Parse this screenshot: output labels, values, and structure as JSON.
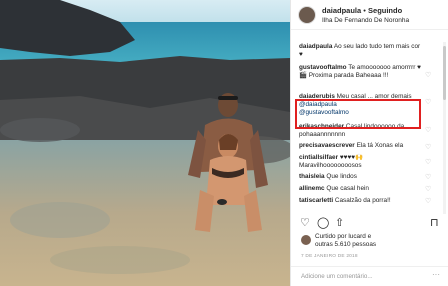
{
  "post": {
    "username": "daiadpaula",
    "separator": "•",
    "follow_label": "Seguindo",
    "location": "Ilha De Fernando De Noronha"
  },
  "comments": [
    {
      "user": "daiadpaula",
      "text": "Ao seu lado tudo tem mais cor",
      "extra": "♥"
    },
    {
      "user": "gustavooftalmo",
      "text": "Te amooooooo amorrrrr ♥🎬 Proxima parada Baheaaa !!!"
    },
    {
      "user": "daiaderubis",
      "text": "Meu casal ... amor demais",
      "mention1": "@daiadpaula",
      "mention2": "@gustavooftalmo"
    },
    {
      "user": "erikaschneider",
      "text": "Casal lindoooooo da pohaaannnnnnn"
    },
    {
      "user": "precisavaescrever",
      "text": "Ela tá Xonas ela"
    },
    {
      "user": "cintiallsilfaer",
      "text": "♥♥♥♥🙌 Maravilhoooooooosos"
    },
    {
      "user": "thaisleia",
      "text": "Que lindos"
    },
    {
      "user": "allinemc",
      "text": "Que casal hein"
    },
    {
      "user": "tatiscarletti",
      "text": "Casalzão da porra!!"
    }
  ],
  "actions": {
    "like_icon": "heart-icon",
    "comment_icon": "comment-icon",
    "share_icon": "share-icon",
    "save_icon": "bookmark-icon"
  },
  "likes": {
    "line1": "Curtido por lucard e",
    "line2": "outras 5.610 pessoas"
  },
  "date": "7 DE JANEIRO DE 2018",
  "add_comment": {
    "placeholder": "Adicione um comentário...",
    "more": "···"
  }
}
